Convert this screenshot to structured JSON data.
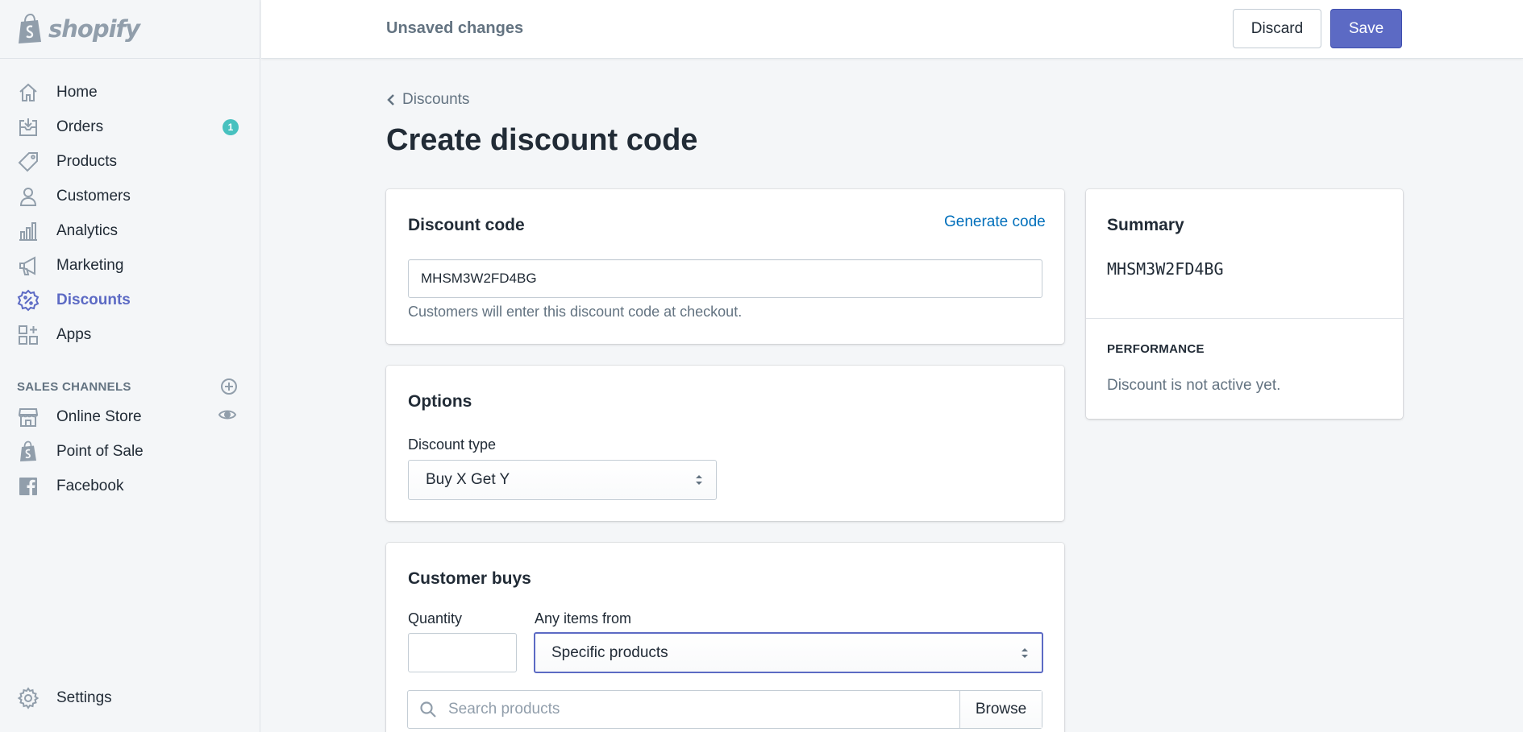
{
  "brand": {
    "name": "shopify"
  },
  "sidebar": {
    "items": [
      {
        "label": "Home",
        "icon": "home-icon"
      },
      {
        "label": "Orders",
        "icon": "orders-icon",
        "badge": "1"
      },
      {
        "label": "Products",
        "icon": "tag-icon"
      },
      {
        "label": "Customers",
        "icon": "person-icon"
      },
      {
        "label": "Analytics",
        "icon": "bar-chart-icon"
      },
      {
        "label": "Marketing",
        "icon": "megaphone-icon"
      },
      {
        "label": "Discounts",
        "icon": "discount-icon",
        "active": true
      },
      {
        "label": "Apps",
        "icon": "apps-icon"
      }
    ],
    "sales_channels_title": "SALES CHANNELS",
    "channels": [
      {
        "label": "Online Store",
        "icon": "store-icon"
      },
      {
        "label": "Point of Sale",
        "icon": "shopify-bag-icon"
      },
      {
        "label": "Facebook",
        "icon": "facebook-icon"
      }
    ],
    "settings_label": "Settings"
  },
  "topbar": {
    "status": "Unsaved changes",
    "discard_label": "Discard",
    "save_label": "Save"
  },
  "breadcrumb": "Discounts",
  "page_title": "Create discount code",
  "discount_code_card": {
    "title": "Discount code",
    "generate_label": "Generate code",
    "code_value": "MHSM3W2FD4BG",
    "help": "Customers will enter this discount code at checkout."
  },
  "options_card": {
    "title": "Options",
    "type_label": "Discount type",
    "type_value": "Buy X Get Y"
  },
  "customer_buys_card": {
    "title": "Customer buys",
    "quantity_label": "Quantity",
    "quantity_value": "",
    "items_label": "Any items from",
    "items_value": "Specific products",
    "search_placeholder": "Search products",
    "browse_label": "Browse"
  },
  "summary_card": {
    "title": "Summary",
    "code": "MHSM3W2FD4BG",
    "performance_title": "PERFORMANCE",
    "performance_text": "Discount is not active yet."
  },
  "colors": {
    "accent": "#5c6ac4",
    "link": "#006fbb",
    "badge": "#47c1bf",
    "background": "#f4f6f8"
  }
}
